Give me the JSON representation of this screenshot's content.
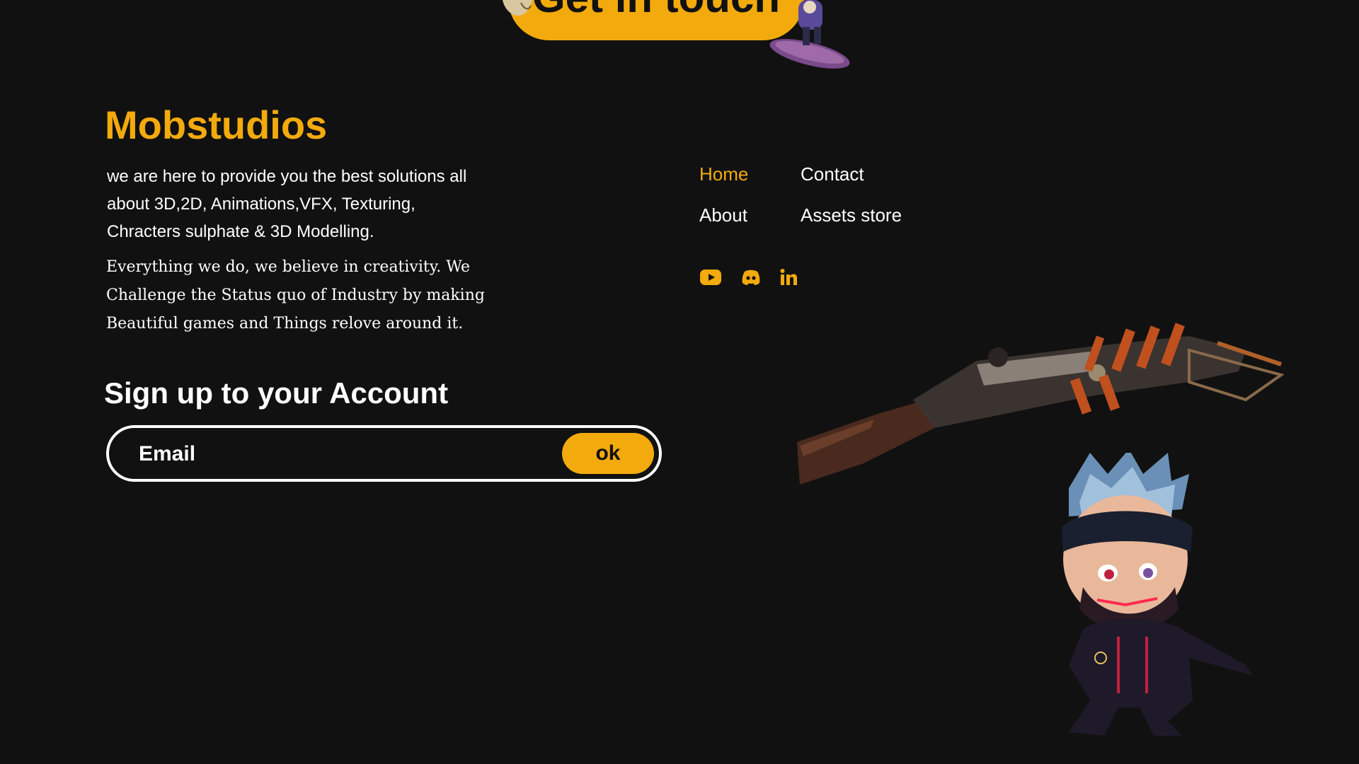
{
  "cta": {
    "label": "Get in touch"
  },
  "brand": {
    "name": "Mobstudios"
  },
  "about": {
    "tagline": "we are here to provide you the best solutions all about 3D,2D, Animations,VFX, Texturing, Chracters sulphate & 3D Modelling.",
    "creed": "Everything we do, we believe in creativity. We Challenge the Status quo of Industry by making Beautiful games and Things relove around it."
  },
  "signup": {
    "title": "Sign up to your Account",
    "email_placeholder": "Email",
    "submit_label": "ok"
  },
  "nav": {
    "home": "Home",
    "contact": "Contact",
    "about": "About",
    "assets_store": "Assets store"
  },
  "social": {
    "icons": [
      "youtube-icon",
      "discord-icon",
      "linkedin-icon"
    ]
  },
  "colors": {
    "background": "#111111",
    "accent": "#f3aa0d",
    "text": "#ffffff"
  }
}
